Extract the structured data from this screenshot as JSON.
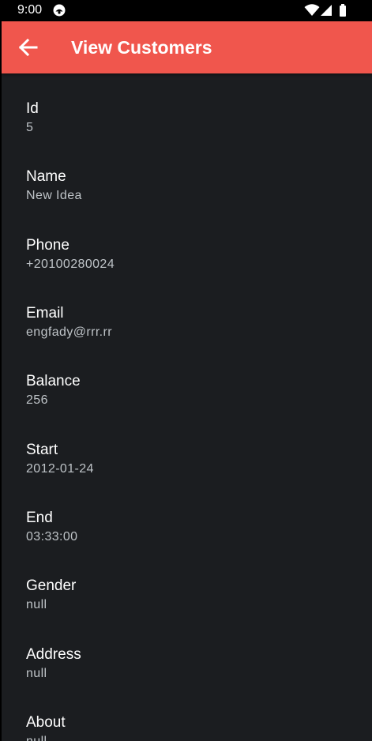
{
  "status_bar": {
    "time": "9:00",
    "icons": [
      "notification-icon",
      "wifi-icon",
      "signal-icon",
      "battery-icon"
    ]
  },
  "app_bar": {
    "title": "View Customers",
    "back_icon": "arrow-back-icon",
    "color": "#F0564D"
  },
  "theme": {
    "background": "#1B1D20",
    "label_color": "#FFFFFF",
    "value_color": "#BEC3C7"
  },
  "fields": [
    {
      "label": "Id",
      "value": "5"
    },
    {
      "label": "Name",
      "value": "New Idea"
    },
    {
      "label": "Phone",
      "value": "+20100280024"
    },
    {
      "label": "Email",
      "value": "engfady@rrr.rr"
    },
    {
      "label": "Balance",
      "value": "256"
    },
    {
      "label": "Start",
      "value": "2012-01-24"
    },
    {
      "label": "End",
      "value": "03:33:00"
    },
    {
      "label": "Gender",
      "value": "null"
    },
    {
      "label": "Address",
      "value": "null"
    },
    {
      "label": "About",
      "value": "null"
    }
  ]
}
